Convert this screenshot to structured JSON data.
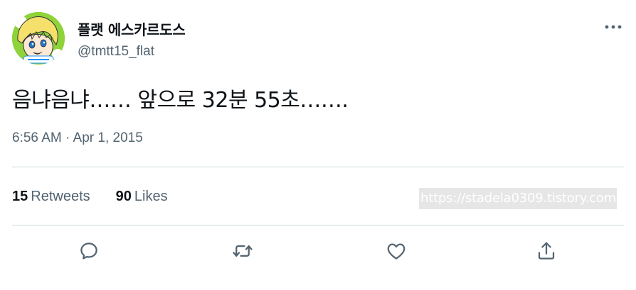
{
  "author": {
    "display_name": "플랫 에스카르도스",
    "handle": "@tmtt15_flat",
    "avatar_icon": "avatar-cartoon-blond-character"
  },
  "tweet": {
    "text": "음냐음냐…… 앞으로 32분 55초…….",
    "timestamp": "6:56 AM · Apr 1, 2015"
  },
  "stats": {
    "retweets_count": "15",
    "retweets_label": "Retweets",
    "likes_count": "90",
    "likes_label": "Likes"
  },
  "watermark": "https://stadela0309.tistory.com",
  "actions": [
    {
      "name": "reply",
      "icon": "reply-icon"
    },
    {
      "name": "retweet",
      "icon": "retweet-icon"
    },
    {
      "name": "like",
      "icon": "heart-icon"
    },
    {
      "name": "share",
      "icon": "share-icon"
    }
  ],
  "colors": {
    "text_primary": "#0f1419",
    "text_secondary": "#536471",
    "divider": "#cfd9de"
  }
}
